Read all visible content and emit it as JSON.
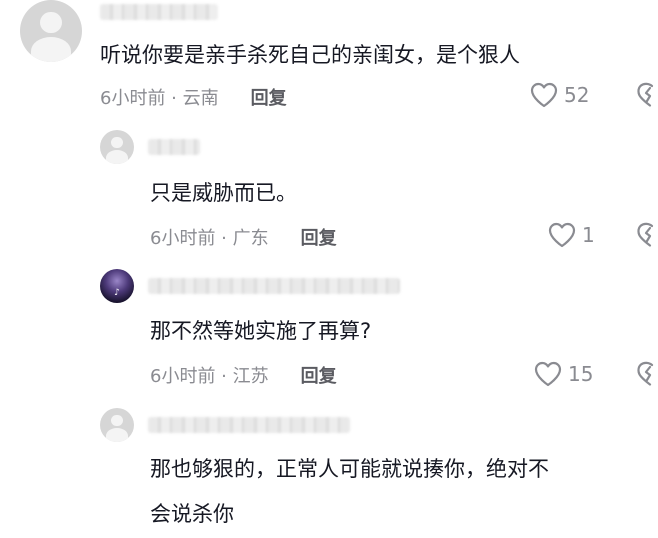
{
  "comments": [
    {
      "text": "听说你要是亲手杀死自己的亲闺女，是个狠人",
      "time": "6小时前 · 云南",
      "reply": "回复",
      "likes": "52"
    },
    {
      "text": "只是威胁而已。",
      "time": "6小时前 · 广东",
      "reply": "回复",
      "likes": "1"
    },
    {
      "text": "那不然等她实施了再算?",
      "time": "6小时前 · 江苏",
      "reply": "回复",
      "likes": "15"
    },
    {
      "text_line1": "那也够狠的，正常人可能就说揍你，绝对不",
      "text_line2": "会说杀你"
    }
  ],
  "icons": {
    "like": "heart-outline-icon",
    "dislike": "broken-heart-icon",
    "avatar_badge": "tiktok-icon"
  },
  "colors": {
    "text": "#161823",
    "meta": "#8a8b91",
    "reply": "#5a5b61"
  }
}
